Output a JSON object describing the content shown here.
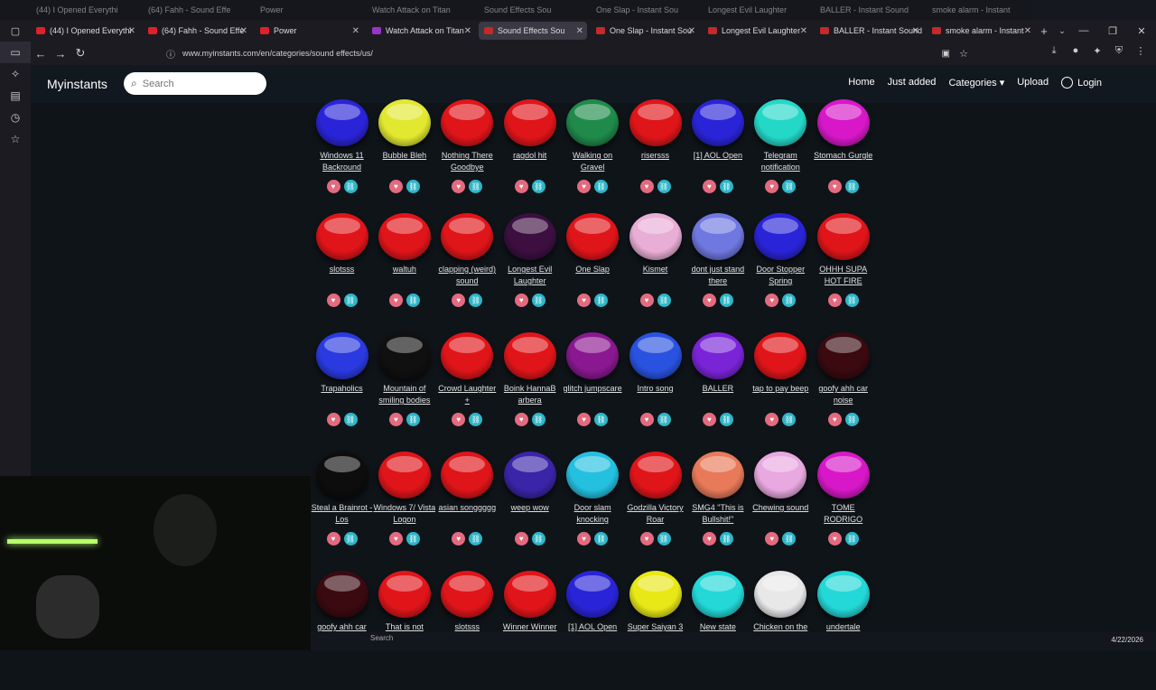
{
  "tabs_ghost": [
    "(44) I Opened Everythi",
    "(64) Fahh - Sound Effe",
    "Power",
    "Watch Attack on Titan",
    "Sound Effects Sou",
    "One Slap - Instant Sou",
    "Longest Evil Laughter",
    "BALLER - Instant Sound",
    "smoke alarm - Instant"
  ],
  "tabs": [
    {
      "label": "(44) I Opened Everythi",
      "color": "#e0202a"
    },
    {
      "label": "(64) Fahh - Sound Effe",
      "color": "#e0202a"
    },
    {
      "label": "Power",
      "color": "#e0202a"
    },
    {
      "label": "Watch Attack on Titan",
      "color": "#9b33c5"
    },
    {
      "label": "Sound Effects Sou",
      "color": "#c32a2a"
    },
    {
      "label": "One Slap - Instant Sou",
      "color": "#c32a2a"
    },
    {
      "label": "Longest Evil Laughter",
      "color": "#c32a2a"
    },
    {
      "label": "BALLER - Instant Sound",
      "color": "#c32a2a"
    },
    {
      "label": "smoke alarm - Instant",
      "color": "#c32a2a"
    }
  ],
  "url": "www.myinstants.com/en/categories/sound effects/us/",
  "site": {
    "brand": "Myinstants",
    "search_placeholder": "Search",
    "menu": [
      "Home",
      "Just added",
      "Categories ▾",
      "Upload"
    ],
    "login": "Login"
  },
  "rows": [
    [
      {
        "label": "Windows 11 Backround",
        "color": "#2a24d8"
      },
      {
        "label": "Bubble Bleh",
        "color": "#e2e830"
      },
      {
        "label": "Nothing There Goodbye",
        "color": "#e0151a"
      },
      {
        "label": "ragdol hit",
        "color": "#e0151a"
      },
      {
        "label": "Walking on Gravel",
        "color": "#1f8a4a"
      },
      {
        "label": "risersss",
        "color": "#e0151a"
      },
      {
        "label": "[1] AOL Open",
        "color": "#2a24d8"
      },
      {
        "label": "Telegram notification",
        "color": "#24d8c8"
      },
      {
        "label": "Stomach Gurgle",
        "color": "#d818c8"
      }
    ],
    [
      {
        "label": "slotsss",
        "color": "#e0151a"
      },
      {
        "label": "waltuh",
        "color": "#e0151a"
      },
      {
        "label": "clapping (weird) sound",
        "color": "#e0151a"
      },
      {
        "label": "Longest Evil Laughter",
        "color": "#3c0f40"
      },
      {
        "label": "One Slap",
        "color": "#e0151a"
      },
      {
        "label": "Kismet",
        "color": "#e9aed6"
      },
      {
        "label": "dont just stand there",
        "color": "#6f78e0"
      },
      {
        "label": "Door Stopper Spring",
        "color": "#2a24d8"
      },
      {
        "label": "OHHH SUPA HOT FIRE",
        "color": "#e0151a"
      }
    ],
    [
      {
        "label": "Trapaholics",
        "color": "#2a3ae0"
      },
      {
        "label": "Mountain of smiling bodies",
        "color": "#101010"
      },
      {
        "label": "Crowd Laughter +",
        "color": "#e0151a"
      },
      {
        "label": "Boink HannaB arbera",
        "color": "#e0151a"
      },
      {
        "label": "glitch jumpscare",
        "color": "#8a1890"
      },
      {
        "label": "Intro song",
        "color": "#2a52e0"
      },
      {
        "label": "BALLER",
        "color": "#7a24d8"
      },
      {
        "label": "tap to pay beep",
        "color": "#e0151a"
      },
      {
        "label": "goofy ahh car noise",
        "color": "#3a0a10"
      }
    ],
    [
      {
        "label": "Steal a Brainrot - Los",
        "color": "#0d0d0d"
      },
      {
        "label": "Windows 7/ Vista Logon",
        "color": "#e0151a"
      },
      {
        "label": "asian songgggg",
        "color": "#e0151a"
      },
      {
        "label": "weep wow",
        "color": "#3a24a8"
      },
      {
        "label": "Door slam knocking",
        "color": "#24c0e0"
      },
      {
        "label": "Godzilla Victory Roar",
        "color": "#e0151a"
      },
      {
        "label": "SMG4 \"This is Bullshit!\"",
        "color": "#e87a5a"
      },
      {
        "label": "Chewing sound",
        "color": "#e8a8e0"
      },
      {
        "label": "TOME RODRIGO",
        "color": "#d818c8"
      }
    ],
    [
      {
        "label": "goofy ahh car",
        "color": "#3a0a10"
      },
      {
        "label": "That is not",
        "color": "#e0151a"
      },
      {
        "label": "slotsss",
        "color": "#e0151a"
      },
      {
        "label": "Winner Winner",
        "color": "#e0151a"
      },
      {
        "label": "[1] AOL Open",
        "color": "#2a24d8"
      },
      {
        "label": "Super Saiyan 3",
        "color": "#e8e818"
      },
      {
        "label": "New state",
        "color": "#24d8d8"
      },
      {
        "label": "Chicken on the",
        "color": "#e8e8e8"
      },
      {
        "label": "undertale",
        "color": "#24d8d8"
      }
    ]
  ],
  "taskbar": {
    "search": "Search",
    "date": "4/22/2026"
  }
}
